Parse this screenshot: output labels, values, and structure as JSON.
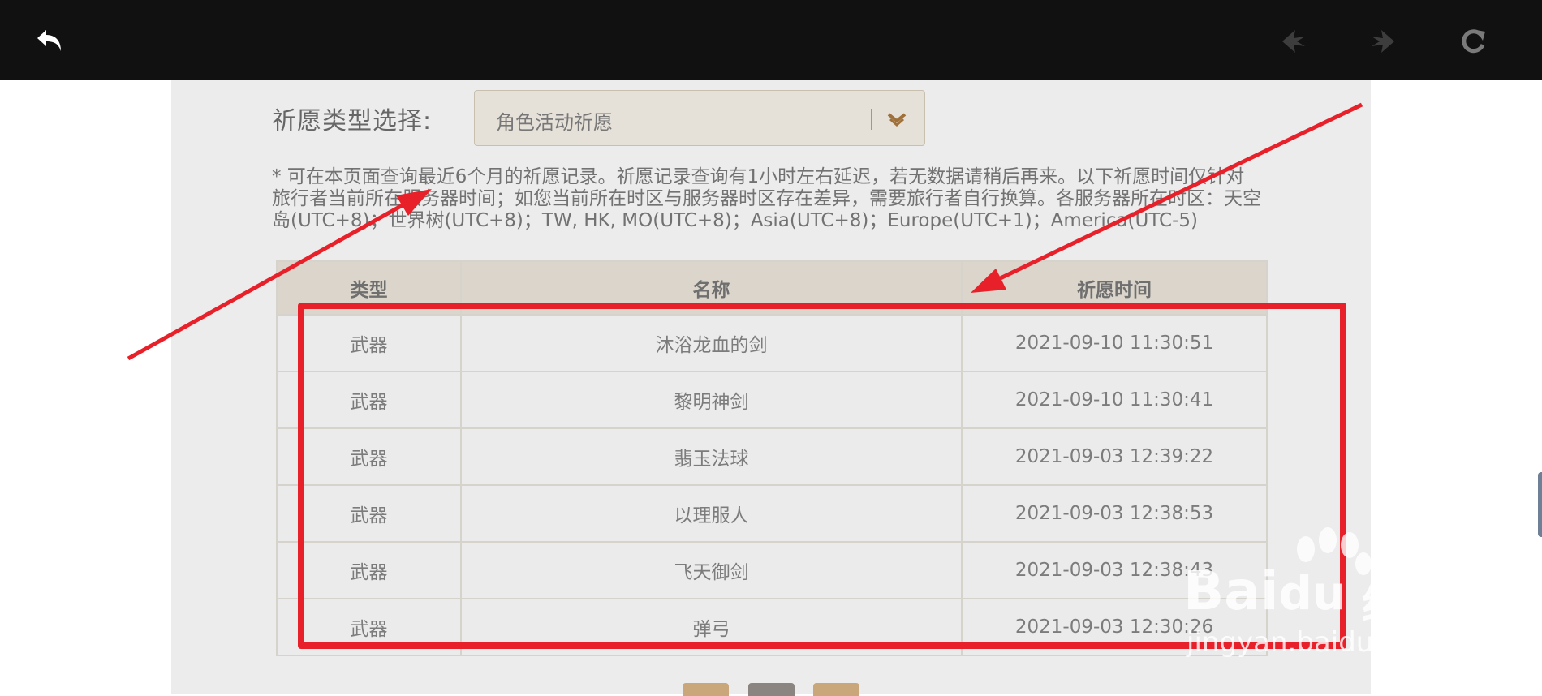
{
  "toolbar": {
    "back_icon": "back-arrow-icon",
    "prev_icon": "nav-prev-icon",
    "next_icon": "nav-next-icon",
    "refresh_icon": "refresh-icon"
  },
  "filter": {
    "label": "祈愿类型选择:",
    "selected": "角色活动祈愿"
  },
  "notice": "* 可在本页面查询最近6个月的祈愿记录。祈愿记录查询有1小时左右延迟，若无数据请稍后再来。以下祈愿时间仅针对旅行者当前所在服务器时间；如您当前所在时区与服务器时区存在差异，需要旅行者自行换算。各服务器所在时区：天空岛(UTC+8)；世界树(UTC+8)；TW, HK, MO(UTC+8)；Asia(UTC+8)；Europe(UTC+1)；America(UTC-5)",
  "table": {
    "headers": [
      "类型",
      "名称",
      "祈愿时间"
    ],
    "rows": [
      {
        "type": "武器",
        "name": "沐浴龙血的剑",
        "time": "2021-09-10 11:30:51"
      },
      {
        "type": "武器",
        "name": "黎明神剑",
        "time": "2021-09-10 11:30:41"
      },
      {
        "type": "武器",
        "name": "翡玉法球",
        "time": "2021-09-03 12:39:22"
      },
      {
        "type": "武器",
        "name": "以理服人",
        "time": "2021-09-03 12:38:53"
      },
      {
        "type": "武器",
        "name": "飞天御剑",
        "time": "2021-09-03 12:38:43"
      },
      {
        "type": "武器",
        "name": "弹弓",
        "time": "2021-09-03 12:30:26"
      }
    ]
  },
  "watermark": {
    "brand": "Bai",
    "brand2": "du",
    "cn": "经验",
    "url": "jingyan.baidu.com"
  },
  "colors": {
    "annotation_red": "#e8202a",
    "header_bg": "#dbd5cb",
    "topbar": "#111111"
  }
}
